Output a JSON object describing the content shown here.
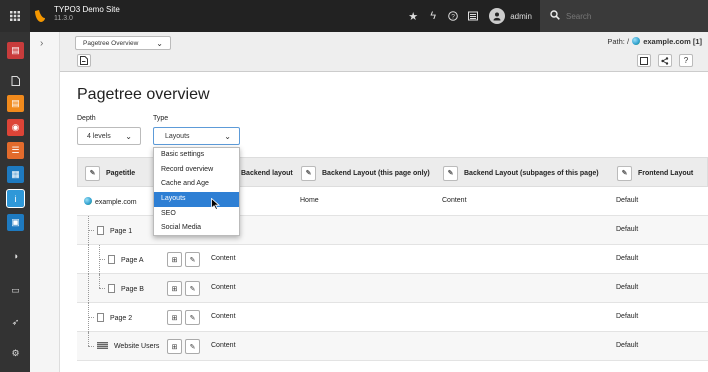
{
  "topbar": {
    "site_name": "TYPO3 Demo Site",
    "version": "11.3.0",
    "username": "admin",
    "search_placeholder": "Search"
  },
  "docheader": {
    "function_select": "Pagetree Overview",
    "path_label": "Path: /",
    "path_page": "example.com [1]"
  },
  "page_title": "Pagetree overview",
  "filters": {
    "depth_label": "Depth",
    "depth_value": "4 levels",
    "type_label": "Type",
    "type_value": "Layouts",
    "type_options": [
      "Basic settings",
      "Record overview",
      "Cache and Age",
      "Layouts",
      "SEO",
      "Social Media"
    ]
  },
  "table": {
    "columns": [
      "Pagetitle",
      "Backend layout",
      "Backend Layout (this page only)",
      "Backend Layout (subpages of this page)",
      "Frontend Layout"
    ],
    "rows": [
      {
        "title": "example.com",
        "backend": "",
        "this_page": "Home",
        "subpages": "Content",
        "frontend": "Default"
      },
      {
        "title": "Page 1",
        "backend": "",
        "this_page": "",
        "subpages": "",
        "frontend": "Default"
      },
      {
        "title": "Page A",
        "backend": "Content",
        "this_page": "",
        "subpages": "",
        "frontend": "Default"
      },
      {
        "title": "Page B",
        "backend": "Content",
        "this_page": "",
        "subpages": "",
        "frontend": "Default"
      },
      {
        "title": "Page 2",
        "backend": "Content",
        "this_page": "",
        "subpages": "",
        "frontend": "Default"
      },
      {
        "title": "Website Users",
        "backend": "Content",
        "this_page": "",
        "subpages": "",
        "frontend": "Default"
      }
    ]
  },
  "colors": {
    "accent": "#2e7fd4",
    "topbar": "#222222",
    "module_bar": "#333333"
  }
}
